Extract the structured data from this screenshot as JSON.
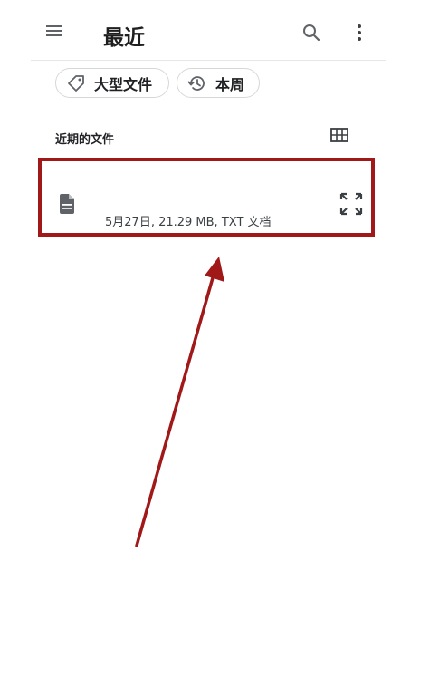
{
  "app_bar": {
    "title": "最近",
    "icons": [
      "menu-icon",
      "search-icon",
      "more-vert-icon"
    ]
  },
  "filters": [
    {
      "label": "大型文件",
      "icon": "label-tag-icon"
    },
    {
      "label": "本周",
      "icon": "history-icon"
    }
  ],
  "section": {
    "title": "近期的文件",
    "view_toggle_icon": "grid-view-icon"
  },
  "files": [
    {
      "meta": "5月27日, 21.29 MB, TXT 文档",
      "icon": "document-icon",
      "action_icon": "expand-icon"
    }
  ],
  "annotation": {
    "highlight_color": "#a01818",
    "arrow_color": "#a01818"
  }
}
